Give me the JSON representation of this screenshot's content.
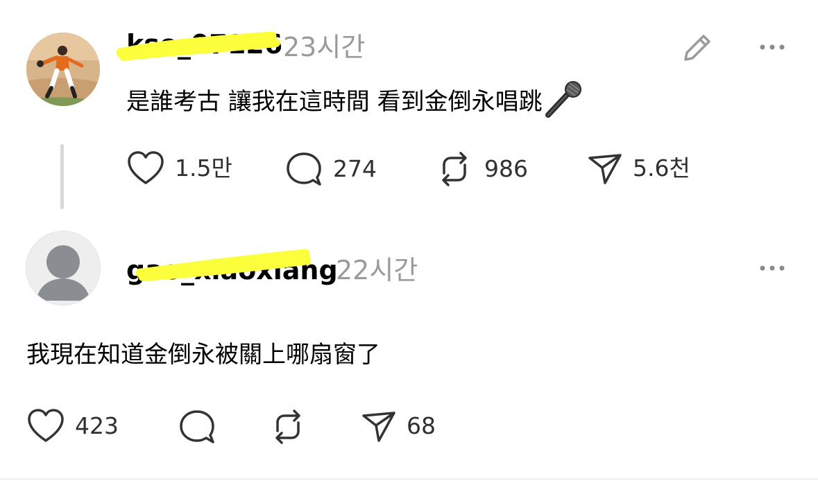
{
  "colors": {
    "highlight": "#fbff3c",
    "muted": "#9a9a9a",
    "divider": "#e4e4e4"
  },
  "post1": {
    "username": "kso_07126",
    "time": "23시간",
    "text": "是誰考古 讓我在這時間 看到金倒永唱跳",
    "emoji": "microphone-icon",
    "actions": {
      "likes": "1.5만",
      "comments": "274",
      "reposts": "986",
      "shares": "5.6천"
    }
  },
  "post2": {
    "username": "gao_xiaoxiang",
    "time": "22시간",
    "text": "我現在知道金倒永被關上哪扇窗了",
    "actions": {
      "likes": "423",
      "shares": "68"
    }
  }
}
